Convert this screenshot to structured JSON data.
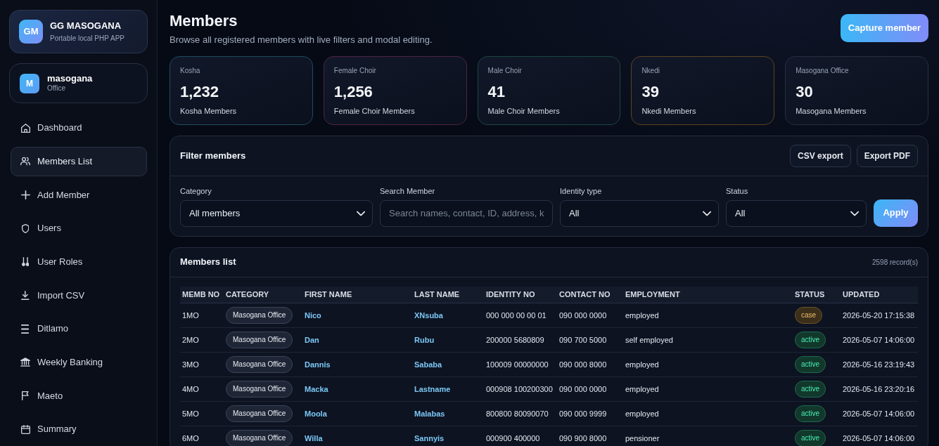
{
  "sidebar": {
    "brand": {
      "logo": "GM",
      "title": "GG MASOGANA",
      "subtitle": "Portable local PHP APP"
    },
    "user": {
      "avatar": "M",
      "name": "masogana",
      "role": "Office"
    },
    "nav": [
      {
        "label": "Dashboard",
        "selected": false
      },
      {
        "label": "Members List",
        "selected": true
      },
      {
        "label": "Add Member",
        "selected": false
      },
      {
        "label": "Users",
        "selected": false
      },
      {
        "label": "User Roles",
        "selected": false
      },
      {
        "label": "Import CSV",
        "selected": false
      },
      {
        "label": "Ditlamo",
        "selected": false
      },
      {
        "label": "Weekly Banking",
        "selected": false
      },
      {
        "label": "Maeto",
        "selected": false
      },
      {
        "label": "Summary",
        "selected": false
      }
    ]
  },
  "header": {
    "title": "Members",
    "subtitle": "Browse all registered members with live filters and modal editing.",
    "action": "Capture member"
  },
  "stats": [
    {
      "label": "Kosha",
      "value": "1,232",
      "caption": "Kosha Members",
      "color": "#1f4b60"
    },
    {
      "label": "Female Choir",
      "value": "1,256",
      "caption": "Female Choir Members",
      "color": "#4f2344"
    },
    {
      "label": "Male Choir",
      "value": "41",
      "caption": "Male Choir Members",
      "color": "#1c4541"
    },
    {
      "label": "Nkedi",
      "value": "39",
      "caption": "Nkedi Members",
      "color": "#5a4420"
    },
    {
      "label": "Masogana Office",
      "value": "30",
      "caption": "Masogana Members",
      "color": "#262f3e"
    }
  ],
  "filter_panel": {
    "title": "Filter members",
    "buttons": [
      "CSV export",
      "Export PDF"
    ],
    "fields": [
      {
        "kind": "select",
        "label": "Category",
        "value": "All members"
      },
      {
        "kind": "search",
        "label": "Search Member",
        "placeholder": "Search names, contact, ID, address, k"
      },
      {
        "kind": "select",
        "label": "Identity type",
        "value": "All"
      },
      {
        "kind": "select",
        "label": "Status",
        "value": "All"
      }
    ],
    "submit": "Apply"
  },
  "members_table": {
    "title": "Members list",
    "count": "2598 record(s)",
    "columns": [
      "MEMB NO",
      "CATEGORY",
      "FIRST NAME",
      "LAST NAME",
      "IDENTITY NO",
      "CONTACT NO",
      "EMPLOYMENT",
      "STATUS",
      "UPDATED"
    ],
    "rows": [
      {
        "memb_no": "1MO",
        "category": "Masogana Office",
        "first_name": "Nico",
        "last_name": "XNsuba",
        "identity_no": "000 000 00 00 01",
        "contact_no": "090 000 0000",
        "employment": "employed",
        "status": {
          "text": "case",
          "color": "#3b2f1a"
        },
        "updated": "2026-05-20 17:15:38"
      },
      {
        "memb_no": "2MO",
        "category": "Masogana Office",
        "first_name": "Dan",
        "last_name": "Rubu",
        "identity_no": "200000 5680809",
        "contact_no": "090 700 5000",
        "employment": "self employed",
        "status": {
          "text": "active",
          "color": "#11382b"
        },
        "updated": "2026-05-07 14:06:00"
      },
      {
        "memb_no": "3MO",
        "category": "Masogana Office",
        "first_name": "Dannis",
        "last_name": "Sababa",
        "identity_no": "100009 00000000",
        "contact_no": "090 000 8000",
        "employment": "employed",
        "status": {
          "text": "active",
          "color": "#11382b"
        },
        "updated": "2026-05-16 23:19:43"
      },
      {
        "memb_no": "4MO",
        "category": "Masogana Office",
        "first_name": "Macka",
        "last_name": "Lastname",
        "identity_no": "000908 100200300",
        "contact_no": "090 000 0000",
        "employment": "employed",
        "status": {
          "text": "active",
          "color": "#11382b"
        },
        "updated": "2026-05-16 23:20:16"
      },
      {
        "memb_no": "5MO",
        "category": "Masogana Office",
        "first_name": "Moola",
        "last_name": "Malabas",
        "identity_no": "800800 80090070",
        "contact_no": "090 000 9999",
        "employment": "employed",
        "status": {
          "text": "active",
          "color": "#11382b"
        },
        "updated": "2026-05-07 14:06:00"
      },
      {
        "memb_no": "6MO",
        "category": "Masogana Office",
        "first_name": "Willa",
        "last_name": "Sannyis",
        "identity_no": "000900 400000",
        "contact_no": "090 900 8000",
        "employment": "pensioner",
        "status": {
          "text": "active",
          "color": "#11382b"
        },
        "updated": "2026-05-07 14:06:00"
      }
    ]
  }
}
